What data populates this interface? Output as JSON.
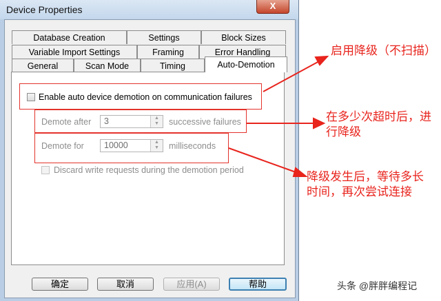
{
  "window": {
    "title": "Device Properties",
    "close_glyph": "X"
  },
  "tabs": {
    "row1": [
      "Database Creation",
      "Settings",
      "Block Sizes"
    ],
    "row2": [
      "Variable Import Settings",
      "Framing",
      "Error Handling"
    ],
    "row3": [
      "General",
      "Scan Mode",
      "Timing",
      "Auto-Demotion"
    ],
    "active": "Auto-Demotion"
  },
  "auto_demotion": {
    "enable_label": "Enable auto device demotion on communication failures",
    "enable_checked": false,
    "demote_after_label": "Demote after",
    "demote_after_value": "3",
    "demote_after_unit": "successive failures",
    "demote_for_label": "Demote for",
    "demote_for_value": "10000",
    "demote_for_unit": "milliseconds",
    "discard_label": "Discard write requests during the demotion period",
    "discard_checked": false
  },
  "buttons": {
    "ok": "确定",
    "cancel": "取消",
    "apply": "应用(A)",
    "help": "帮助"
  },
  "annotations": {
    "enable": "启用降级（不扫描）",
    "timeout": "在多少次超时后，进行降级",
    "retry": "降级发生后，等待多长时间，再次尝试连接"
  },
  "watermark": "头条 @胖胖编程记",
  "colors": {
    "annotation_red": "#e8241d",
    "titlebar": "#c3d7ec"
  }
}
